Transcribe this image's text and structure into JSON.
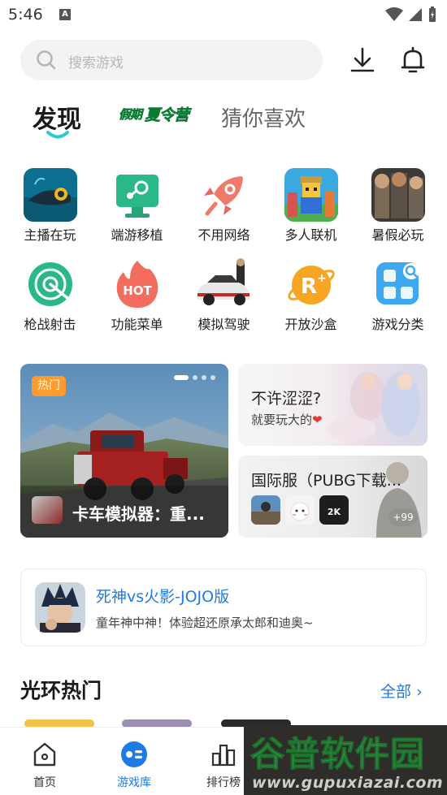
{
  "status_bar": {
    "time": "5:46",
    "indicator": "A"
  },
  "search": {
    "placeholder": "搜索游戏"
  },
  "tabs": {
    "discover": "发现",
    "summer": "假期夏令营",
    "summer_parts": [
      "假期",
      "夏令营"
    ],
    "guess": "猜你喜欢"
  },
  "categories": [
    {
      "label": "主播在玩",
      "icon": "fish-game-icon"
    },
    {
      "label": "端游移植",
      "icon": "steam-monitor-icon"
    },
    {
      "label": "不用网络",
      "icon": "rocket-icon"
    },
    {
      "label": "多人联机",
      "icon": "blocky-game-icon"
    },
    {
      "label": "暑假必玩",
      "icon": "shooter-game-icon"
    },
    {
      "label": "枪战射击",
      "icon": "radar-icon"
    },
    {
      "label": "功能菜单",
      "icon": "hot-flame-icon",
      "badge": "HOT"
    },
    {
      "label": "模拟驾驶",
      "icon": "car-icon"
    },
    {
      "label": "开放沙盒",
      "icon": "planet-r-icon"
    },
    {
      "label": "游戏分类",
      "icon": "grid-search-icon"
    }
  ],
  "banner": {
    "tag": "热门",
    "title": "卡车模拟器：重...",
    "slides": 4,
    "active_slide": 0
  },
  "card_anime": {
    "title": "不许涩涩?",
    "subtitle": "就要玩大的",
    "heart": "❤"
  },
  "card_pubg": {
    "title": "国际服（PUBG下载...",
    "more": "+99"
  },
  "featured": {
    "title": "死神vs火影-JOJO版",
    "desc": "童年神中神！体验超还原承太郎和迪奥~"
  },
  "section": {
    "title": "光环热门",
    "all_label": "全部",
    "chevron": "›"
  },
  "bottom_nav": [
    {
      "label": "首页",
      "icon": "home-icon",
      "active": false
    },
    {
      "label": "游戏库",
      "icon": "game-library-icon",
      "active": true
    },
    {
      "label": "排行榜",
      "icon": "ranking-icon",
      "active": false
    }
  ],
  "watermark": {
    "name": "谷普软件园",
    "url": "www.gupuxiazai.com"
  },
  "colors": {
    "accent": "#1e7be6",
    "hot_tag": "#ff9a2e",
    "watermark_green": "#2ea043"
  }
}
